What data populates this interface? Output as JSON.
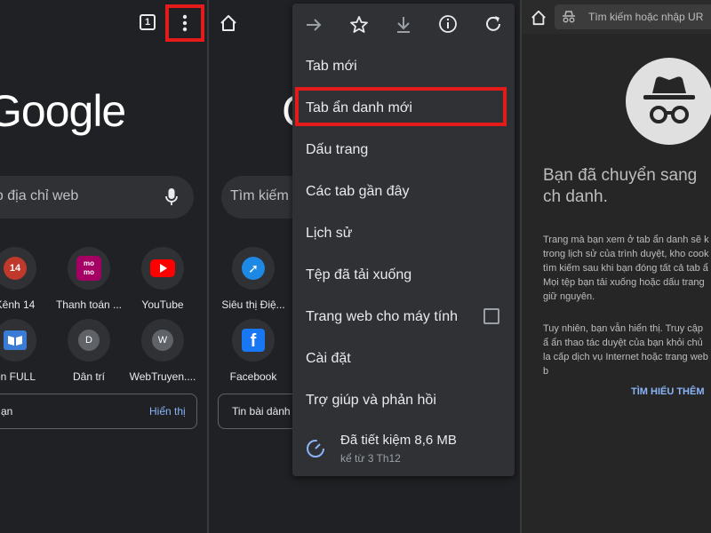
{
  "panel1": {
    "tab_count": "1",
    "google_logo": "Google",
    "search_placeholder": "ập địa chỉ web",
    "shortcuts": [
      {
        "label": "Kênh 14",
        "icon": "kenh14-icon"
      },
      {
        "label": "Thanh toán ...",
        "icon": "momo-icon"
      },
      {
        "label": "YouTube",
        "icon": "youtube-icon"
      },
      {
        "label": "ện FULL",
        "icon": "book-icon"
      },
      {
        "label": "Dân trí",
        "icon": "letter-d-icon",
        "letter": "D"
      },
      {
        "label": "WebTruyen....",
        "icon": "letter-w-icon",
        "letter": "W"
      }
    ],
    "feed_label": "ạn",
    "feed_action": "Hiển thị"
  },
  "panel2": {
    "search_placeholder": "Tìm kiếm",
    "shortcuts": [
      {
        "label": "Siêu thị Điệ...",
        "icon": "running-icon"
      },
      {
        "label": "Facebook",
        "icon": "facebook-icon"
      }
    ],
    "feed_label": "Tin bài dành",
    "menu": {
      "items": [
        {
          "label": "Tab mới"
        },
        {
          "label": "Tab ẩn danh mới"
        },
        {
          "label": "Dấu trang"
        },
        {
          "label": "Các tab gần đây"
        },
        {
          "label": "Lịch sử"
        },
        {
          "label": "Tệp đã tải xuống"
        },
        {
          "label": "Trang web cho máy tính"
        },
        {
          "label": "Cài đặt"
        },
        {
          "label": "Trợ giúp và phản hồi"
        }
      ],
      "savings_title": "Đã tiết kiệm 8,6 MB",
      "savings_sub": "kể từ 3 Th12"
    }
  },
  "panel3": {
    "address_placeholder": "Tìm kiếm hoặc nhập UR",
    "heading": "Bạn đã chuyển sang ch danh.",
    "para1": "Trang mà bạn xem ở tab ẩn danh sẽ k trong lịch sử của trình duyệt, kho cook tìm kiếm sau khi bạn đóng tất cả tab ẩ Mọi tệp bạn tải xuống hoặc dấu trang giữ nguyên.",
    "para2": "Tuy nhiên, bạn vẫn hiển thị. Truy cập ẩ ẩn thao tác duyệt của bạn khỏi chủ la cấp dịch vụ Internet hoặc trang web b",
    "learn_more": "TÌM HIỂU THÊM"
  },
  "colors": {
    "highlight": "#e31b1b",
    "link": "#8ab4f8"
  }
}
